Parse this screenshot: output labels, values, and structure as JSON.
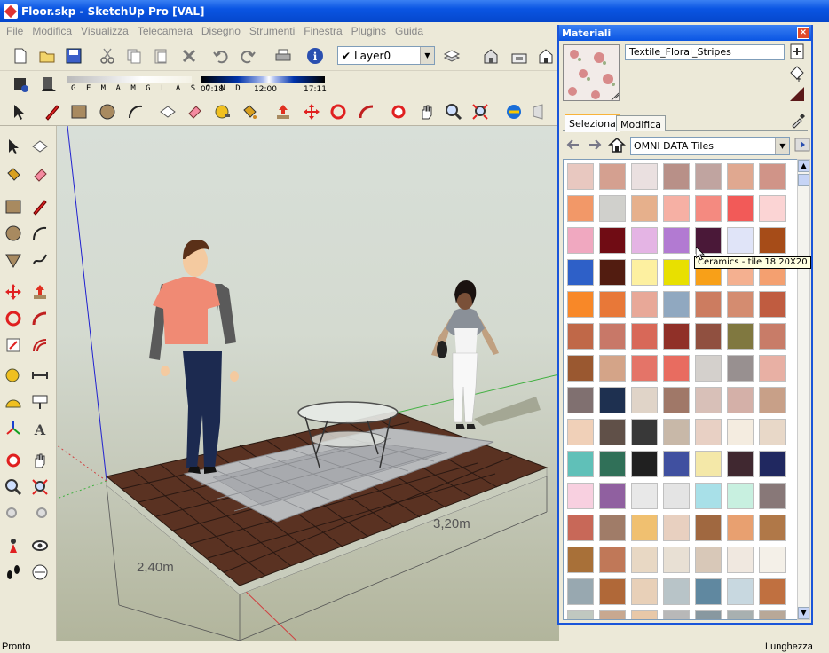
{
  "window": {
    "title": "Floor.skp - SketchUp Pro [VAL]"
  },
  "menu": [
    "File",
    "Modifica",
    "Visualizza",
    "Telecamera",
    "Disegno",
    "Strumenti",
    "Finestra",
    "Plugins",
    "Guida"
  ],
  "layers": {
    "current": "Layer0"
  },
  "shadows": {
    "months": "G F M A M G L A S O N D",
    "time_start": "07:18",
    "time_mid": "12:00",
    "time_end": "17:11"
  },
  "viewport": {
    "dim_width": "2,40m",
    "dim_length": "3,20m"
  },
  "status": {
    "left": "Pronto",
    "right": "Lunghezza"
  },
  "materials": {
    "title": "Materiali",
    "close": "×",
    "current_name": "Textile_Floral_Stripes",
    "tabs": [
      "Seleziona",
      "Modifica"
    ],
    "library": "OMNI DATA Tiles",
    "tooltip": "Ceramics - tile 18 20X20",
    "swatch_rows": [
      [
        "#e8c8c0",
        "#d4a090",
        "#eae0e0",
        "#b89088",
        "#c0a4a0",
        "#e0a890",
        "#d09488"
      ],
      [
        "#f29868",
        "#d0d0cc",
        "#e6b08c",
        "#f6b0a4",
        "#f48a80",
        "#f25a58",
        "#fbd4d4"
      ],
      [
        "#f0a8c0",
        "#700c14",
        "#e4b4e4",
        "#b27ad2",
        "#4a1838",
        "#e0e4f8",
        "#a64c18"
      ],
      [
        "#2e60c8",
        "#521c10",
        "#fdf0a0",
        "#e8e000",
        "#f8a018",
        "#f4b090",
        "#f4a070"
      ],
      [
        "#f88828",
        "#e87838",
        "#e8a898",
        "#90a8c0",
        "#cc7c60",
        "#d48c70",
        "#c05c40"
      ],
      [
        "#c06848",
        "#c87868",
        "#d86858",
        "#903028",
        "#905040",
        "#807840",
        "#c87c68"
      ],
      [
        "#9a5830",
        "#d4a488",
        "#e47468",
        "#e86c60",
        "#d4d0cc",
        "#989090",
        "#e8b0a4"
      ],
      [
        "#807070",
        "#1e3050",
        "#e0d4c8",
        "#a07868",
        "#d8c0b8",
        "#d4b0a8",
        "#c8a088"
      ],
      [
        "#f0d0b8",
        "#605048",
        "#383838",
        "#c8b8a8",
        "#e8d0c4",
        "#f4ece0",
        "#e8d8c8"
      ],
      [
        "#60c0b8",
        "#307058",
        "#202020",
        "#4050a0",
        "#f4e8a8",
        "#402830",
        "#202860"
      ],
      [
        "#f8d0e0",
        "#9060a0",
        "#e8e8e8",
        "#e4e4e4",
        "#a8e0e8",
        "#c8f0e0",
        "#887878"
      ],
      [
        "#c86858",
        "#a07c68",
        "#f0c070",
        "#e8d0c0",
        "#a06840",
        "#e8a070",
        "#b07848"
      ],
      [
        "#a87038",
        "#c07858",
        "#e8d8c4",
        "#e8e0d4",
        "#d8c8b8",
        "#f0e8e0",
        "#f4f0e8"
      ],
      [
        "#98a8b0",
        "#b06838",
        "#e8d0b8",
        "#b8c4c8",
        "#6088a0",
        "#c8d8e0",
        "#c07040"
      ],
      [
        "#c0c8c0",
        "#c8a890",
        "#e8c8a8",
        "#b8b8b8",
        "#8898a0",
        "#a8b0b0",
        "#b8a898"
      ]
    ]
  }
}
